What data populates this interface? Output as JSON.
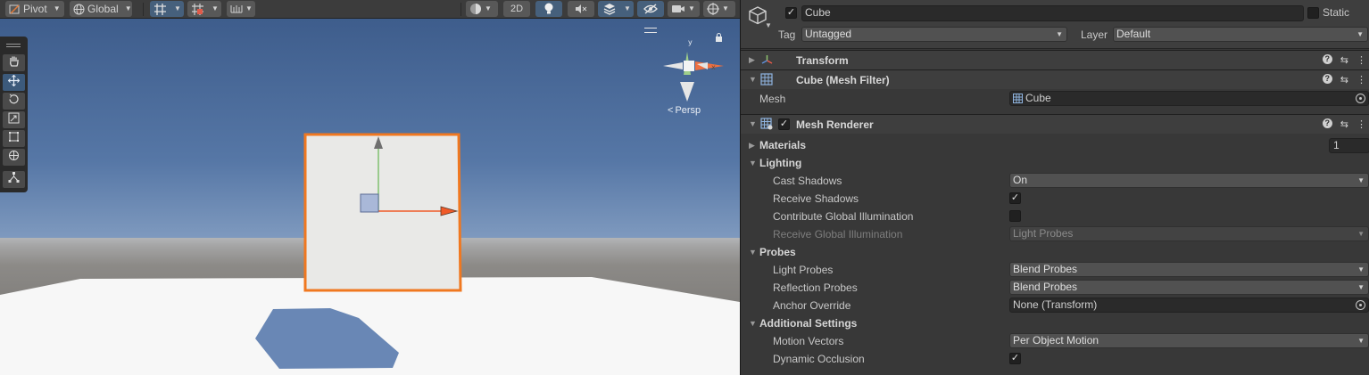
{
  "scene_toolbar": {
    "pivot_label": "Pivot",
    "global_label": "Global",
    "mode_2d_label": "2D"
  },
  "scene_view": {
    "projection_label": "Persp",
    "gizmo_axes": [
      "y",
      "x",
      "z"
    ]
  },
  "inspector": {
    "object_name": "Cube",
    "object_active": true,
    "static_label": "Static",
    "static_checked": false,
    "tag_label": "Tag",
    "tag_value": "Untagged",
    "layer_label": "Layer",
    "layer_value": "Default",
    "components": {
      "transform": {
        "title": "Transform"
      },
      "mesh_filter": {
        "title": "Cube (Mesh Filter)",
        "mesh_label": "Mesh",
        "mesh_value": "Cube"
      },
      "mesh_renderer": {
        "title": "Mesh Renderer",
        "enabled": true,
        "materials_label": "Materials",
        "materials_count": "1",
        "lighting_label": "Lighting",
        "cast_shadows_label": "Cast Shadows",
        "cast_shadows_value": "On",
        "receive_shadows_label": "Receive Shadows",
        "receive_shadows_checked": true,
        "contribute_gi_label": "Contribute Global Illumination",
        "contribute_gi_checked": false,
        "receive_gi_label": "Receive Global Illumination",
        "receive_gi_value": "Light Probes",
        "probes_label": "Probes",
        "light_probes_label": "Light Probes",
        "light_probes_value": "Blend Probes",
        "reflection_probes_label": "Reflection Probes",
        "reflection_probes_value": "Blend Probes",
        "anchor_override_label": "Anchor Override",
        "anchor_override_value": "None (Transform)",
        "additional_settings_label": "Additional Settings",
        "motion_vectors_label": "Motion Vectors",
        "motion_vectors_value": "Per Object Motion",
        "dynamic_occlusion_label": "Dynamic Occlusion",
        "dynamic_occlusion_checked": true
      }
    }
  },
  "colors": {
    "selection_outline": "#f07820",
    "sky_top": "#3e5d8c",
    "inspector_bg": "#383838",
    "active_tool": "#3c5a7b"
  }
}
